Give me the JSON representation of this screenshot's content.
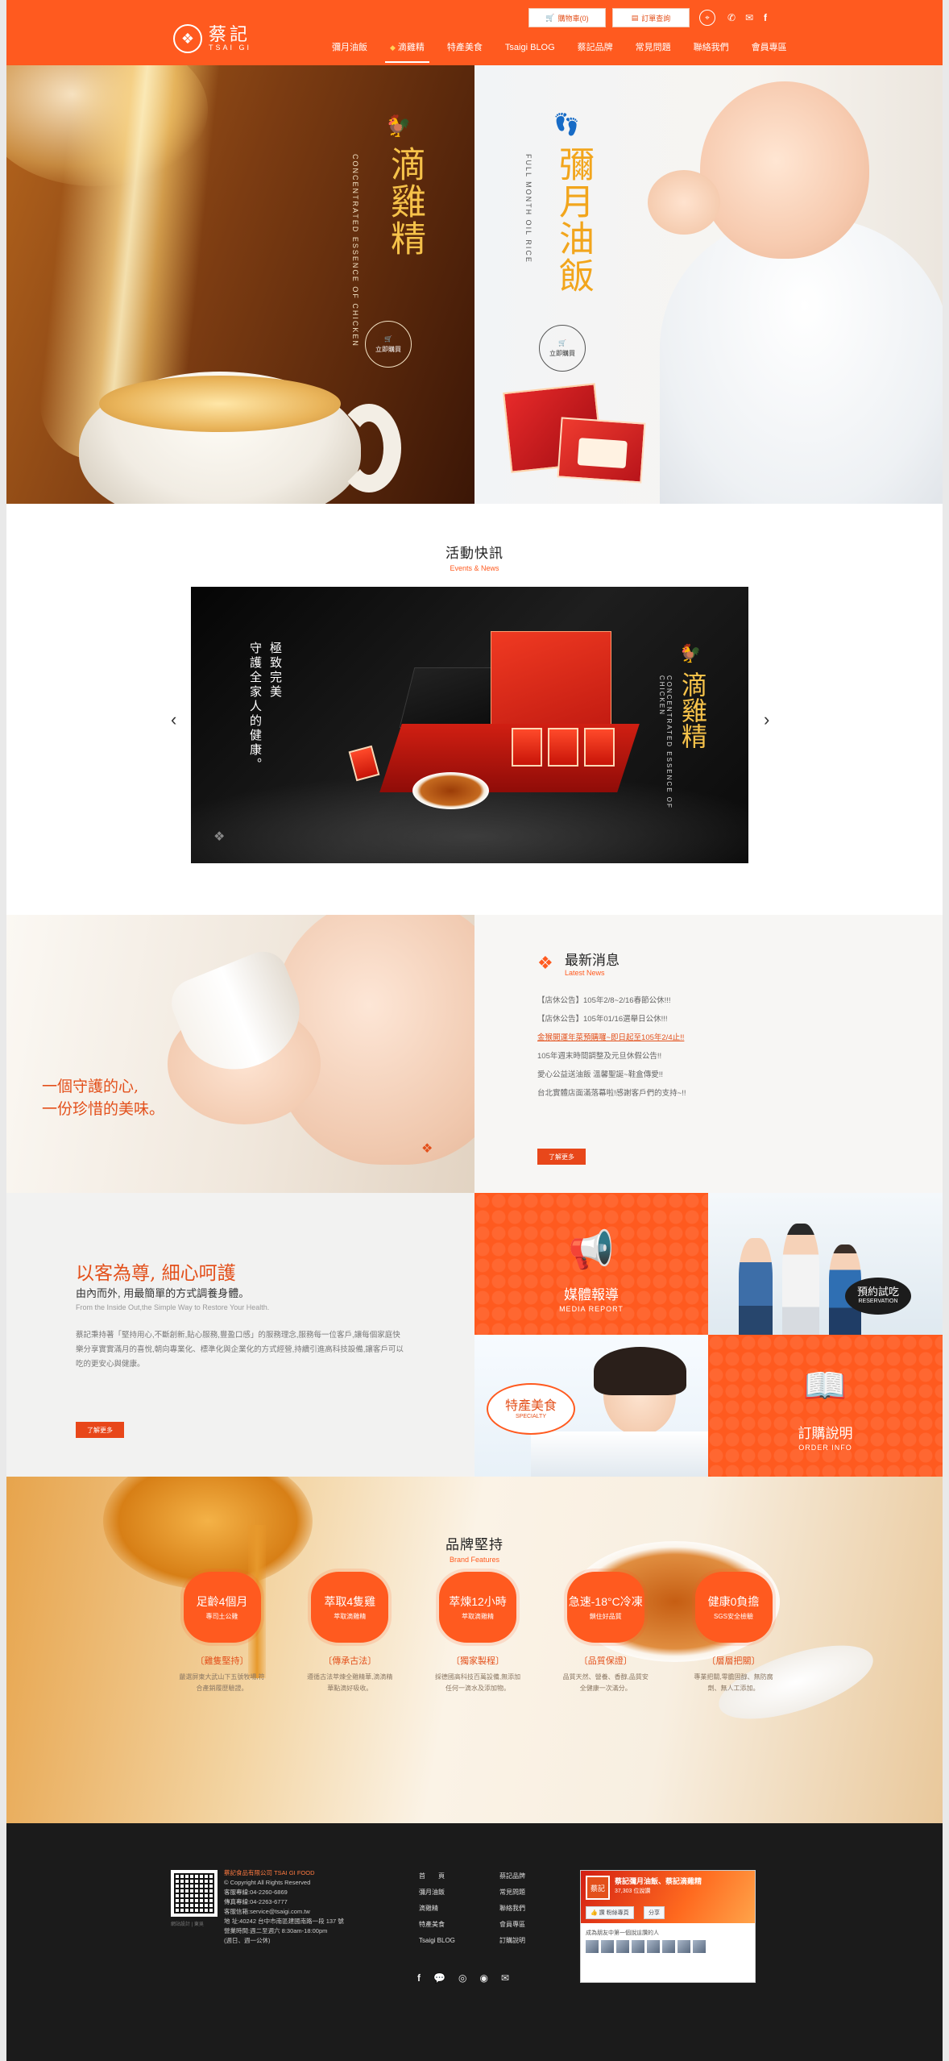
{
  "utility": {
    "cart_label": "購物車(0)",
    "order_label": "訂單查詢"
  },
  "brand": {
    "name_cn": "蔡記",
    "name_en": "TSAI GI",
    "accent": "#ff5a1f"
  },
  "nav": {
    "items": [
      {
        "label": "彌月油飯"
      },
      {
        "label": "滴雞精"
      },
      {
        "label": "特產美食"
      },
      {
        "label": "Tsaigi BLOG"
      },
      {
        "label": "蔡記品牌"
      },
      {
        "label": "常見問題"
      },
      {
        "label": "聯絡我們"
      },
      {
        "label": "會員專區"
      }
    ]
  },
  "hero": {
    "left": {
      "title": "滴雞精",
      "en": "CONCENTRATED ESSENCE OF CHICKEN",
      "button": "立即購買"
    },
    "right": {
      "title": "彌月油飯",
      "en": "FULL MONTH OIL RICE",
      "button": "立即購買"
    }
  },
  "events": {
    "title": "活動快訊",
    "subtitle": "Events & News",
    "banner_slogan_1": "極致完美",
    "banner_slogan_2": "守護全家人的健康。",
    "banner_product": "滴雞精",
    "banner_en": "CONCENTRATED ESSENCE OF CHICKEN",
    "prev": "‹",
    "next": "›"
  },
  "sip": {
    "line1": "一個守護的心,",
    "line2": "一份珍惜的美味。"
  },
  "news": {
    "title": "最新消息",
    "subtitle": "Latest News",
    "items": [
      {
        "text": "【店休公告】105年2/8~2/16春節公休!!!"
      },
      {
        "text": "【店休公告】105年01/16選舉日公休!!!"
      },
      {
        "text": "金猴開運年菜預購囉~即日起至105年2/4止!!"
      },
      {
        "text": "105年週末時間調整及元旦休假公告!!"
      },
      {
        "text": "愛心公益送油飯 溫馨聖誕~鞋盒傳愛!!"
      },
      {
        "text": "台北實體店面滿落幕啦!感謝客戶們的支持~!!"
      }
    ],
    "more": "了解更多"
  },
  "service": {
    "title": "以客為尊, 細心呵護",
    "subtitle": "由內而外, 用最簡單的方式調養身體。",
    "en": "From the Inside Out,the Simple Way to Restore Your Health.",
    "body": "蔡記秉持著「堅持用心,不斷創新,貼心服務,豐盈口感」的服務理念,服務每一位客戶,讓每個家庭快樂分享實實滿月的喜悅,朝向專業化、標準化與企業化的方式經營,持續引進高科技設備,讓客戶可以吃的更安心與健康。",
    "more": "了解更多"
  },
  "tiles": {
    "media": {
      "cn": "媒體報導",
      "en": "MEDIA REPORT"
    },
    "reserve": {
      "cn": "預約試吃",
      "en": "RESERVATION"
    },
    "specialty": {
      "cn": "特產美食",
      "en": "SPECIALTY"
    },
    "order": {
      "cn": "訂購說明",
      "en": "ORDER INFO"
    }
  },
  "features": {
    "title": "品牌堅持",
    "subtitle": "Brand Features",
    "badges": [
      {
        "main": "足齡4個月",
        "sub": "專司土公雞",
        "title": "〔雞隻堅持〕",
        "desc": "嚴選屏東大武山下五號牧場,符合產銷履歷驗證。"
      },
      {
        "main": "萃取4隻雞",
        "sub": "萃取滴雞精",
        "title": "〔傳承古法〕",
        "desc": "遵循古法萃煉全雞精華,滴滴精華點滴好吸收。"
      },
      {
        "main": "萃煉12小時",
        "sub": "萃取滴雞精",
        "title": "〔獨家製程〕",
        "desc": "採德國高科技百萬設備,無添加任何一滴水及添加物。"
      },
      {
        "main": "急速-18°C冷凍",
        "sub": "鎖住好品質",
        "title": "〔品質保證〕",
        "desc": "品質天然、營養、香醇,品質安全健康一次滿分。"
      },
      {
        "main": "健康0負擔",
        "sub": "SGS安全檢驗",
        "title": "〔層層把關〕",
        "desc": "專業把關,零膽固醇、無防腐劑、無人工添加。"
      }
    ]
  },
  "footer": {
    "company": "蔡記食品有限公司 TSAI GI FOOD",
    "copyright": "© Copyright All Rights Reserved",
    "phone1": "客服專線:04-2260-6869",
    "phone2": "傳真專線:04-2263-6777",
    "email": "客服信箱:service@tsaigi.com.tw",
    "address": "地    址:40242 台中市南區建國南路一段 137 號",
    "hours": "營業時間:週二至週六 8:30am-18:00pm",
    "hours2": "(週日、週一公休)",
    "qr_note": "網站設計 | 東吳",
    "links_col1": [
      "首　　頁",
      "彌月油飯",
      "滴雞精",
      "特產美食",
      "Tsaigi BLOG"
    ],
    "links_col2": [
      "蔡記品牌",
      "常見問題",
      "聯絡我們",
      "會員專區",
      "訂購說明"
    ],
    "fb_name": "蔡記彌月油飯、蔡記滴雞精",
    "fb_likes": "37,303 位說讚",
    "fb_like": "👍 讚 粉絲專頁",
    "fb_share": "分享",
    "fb_friends": "成為朋友中第一個說這讚的人"
  }
}
